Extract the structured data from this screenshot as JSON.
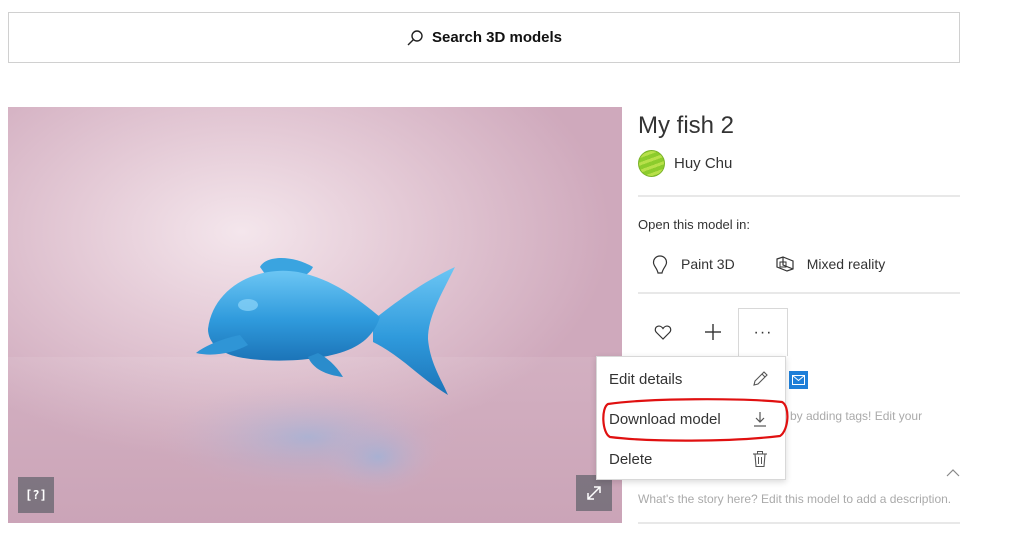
{
  "search": {
    "label": "Search 3D models",
    "icon": "search-icon"
  },
  "viewer": {
    "help_label": "[?]",
    "help_icon": "help-icon",
    "expand_icon": "expand-icon",
    "background_color": "#e4cad6",
    "fish_color": "#3aa4e0"
  },
  "model": {
    "title": "My fish 2",
    "author": "Huy Chu"
  },
  "open_in": {
    "label": "Open this model in:",
    "apps": [
      {
        "label": "Paint 3D",
        "icon": "paint-3d-icon"
      },
      {
        "label": "Mixed reality",
        "icon": "mixed-reality-icon"
      }
    ]
  },
  "actions": {
    "like_icon": "heart-icon",
    "add_icon": "plus-icon",
    "more_label": "···"
  },
  "context_menu": {
    "items": [
      {
        "label": "Edit details",
        "icon": "pencil-icon"
      },
      {
        "label": "Download model",
        "icon": "download-icon"
      },
      {
        "label": "Delete",
        "icon": "trash-icon"
      }
    ],
    "highlight_color": "#e01010"
  },
  "tags_hint": "by adding tags! Edit your",
  "description_hint": "What's the story here? Edit this model to add a description.",
  "share_icon": "mail-icon",
  "chevron_icon": "chevron-up-icon",
  "accent_color": "#1e7fd8"
}
